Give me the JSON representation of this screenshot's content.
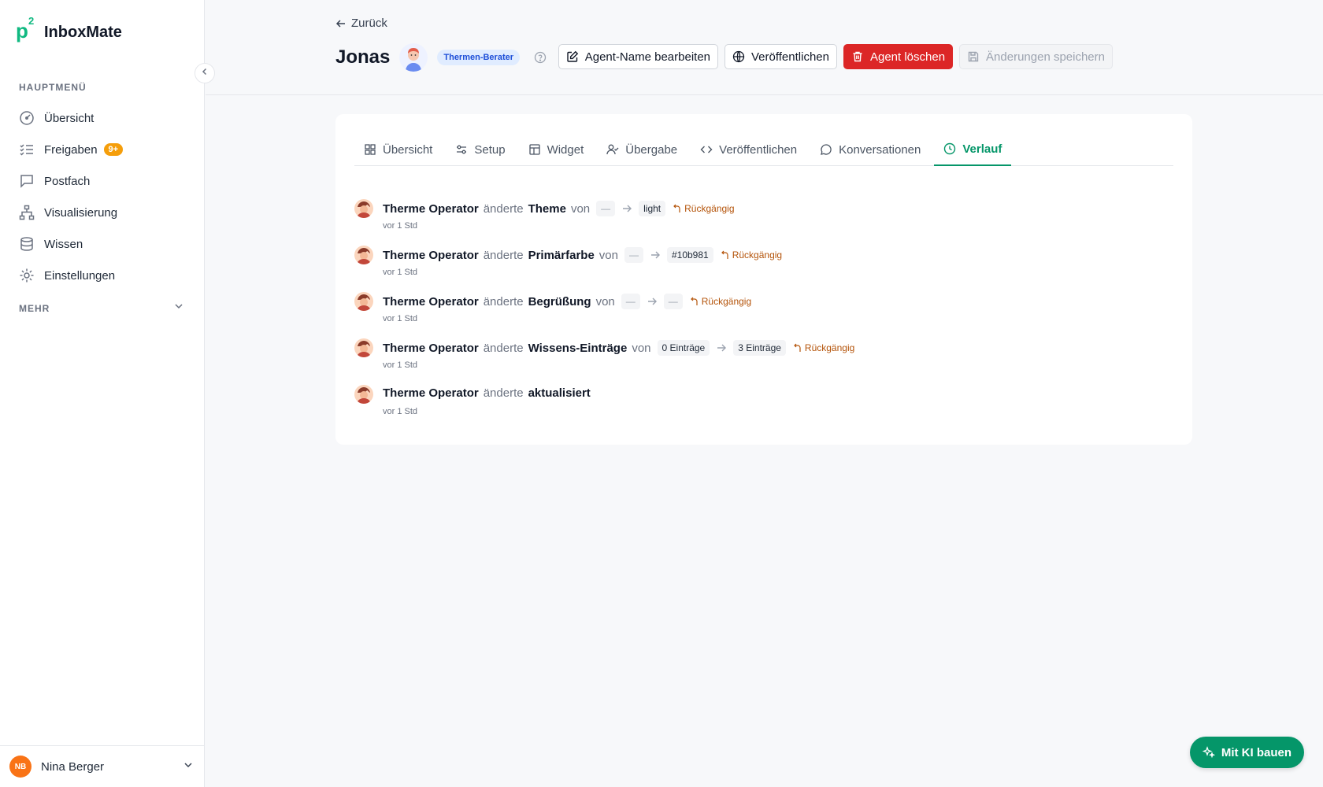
{
  "app": {
    "logo_mark": "p",
    "logo_sup": "2",
    "name": "InboxMate"
  },
  "sidebar": {
    "main_label": "HAUPTMENÜ",
    "items": [
      {
        "label": "Übersicht",
        "icon": "gauge-icon"
      },
      {
        "label": "Freigaben",
        "icon": "checklist-icon",
        "badge": "9+"
      },
      {
        "label": "Postfach",
        "icon": "chat-icon"
      },
      {
        "label": "Visualisierung",
        "icon": "sitemap-icon"
      },
      {
        "label": "Wissen",
        "icon": "database-icon"
      },
      {
        "label": "Einstellungen",
        "icon": "gear-icon"
      }
    ],
    "more_label": "MEHR",
    "user": {
      "initials": "NB",
      "name": "Nina Berger"
    }
  },
  "header": {
    "back_label": "Zurück",
    "agent_name": "Jonas",
    "agent_role": "Thermen-Berater",
    "actions": {
      "edit_name": "Agent-Name bearbeiten",
      "publish": "Veröffentlichen",
      "delete": "Agent löschen",
      "save": "Änderungen speichern"
    }
  },
  "tabs": [
    {
      "label": "Übersicht",
      "icon": "grid-icon"
    },
    {
      "label": "Setup",
      "icon": "sliders-icon"
    },
    {
      "label": "Widget",
      "icon": "layout-icon"
    },
    {
      "label": "Übergabe",
      "icon": "user-check-icon"
    },
    {
      "label": "Veröffentlichen",
      "icon": "code-icon"
    },
    {
      "label": "Konversationen",
      "icon": "message-icon"
    },
    {
      "label": "Verlauf",
      "icon": "clock-icon",
      "active": true
    }
  ],
  "history": {
    "verb": "änderte",
    "von": "von",
    "undo_label": "Rückgängig",
    "items": [
      {
        "user": "Therme Operator",
        "field": "Theme",
        "from": "—",
        "to": "light",
        "time": "vor 1 Std"
      },
      {
        "user": "Therme Operator",
        "field": "Primärfarbe",
        "from": "—",
        "to": "#10b981",
        "time": "vor 1 Std"
      },
      {
        "user": "Therme Operator",
        "field": "Begrüßung",
        "from": "—",
        "to": "—",
        "time": "vor 1 Std"
      },
      {
        "user": "Therme Operator",
        "field": "Wissens-Einträge",
        "from": "0 Einträge",
        "to": "3 Einträge",
        "time": "vor 1 Std"
      },
      {
        "user": "Therme Operator",
        "field": "aktualisiert",
        "time": "vor 1 Std"
      }
    ]
  },
  "fab_label": "Mit KI bauen",
  "colors": {
    "accent": "#059669",
    "logo": "#10b981",
    "danger": "#dc2626",
    "badge": "#f59e0b",
    "undo": "#b45309"
  }
}
